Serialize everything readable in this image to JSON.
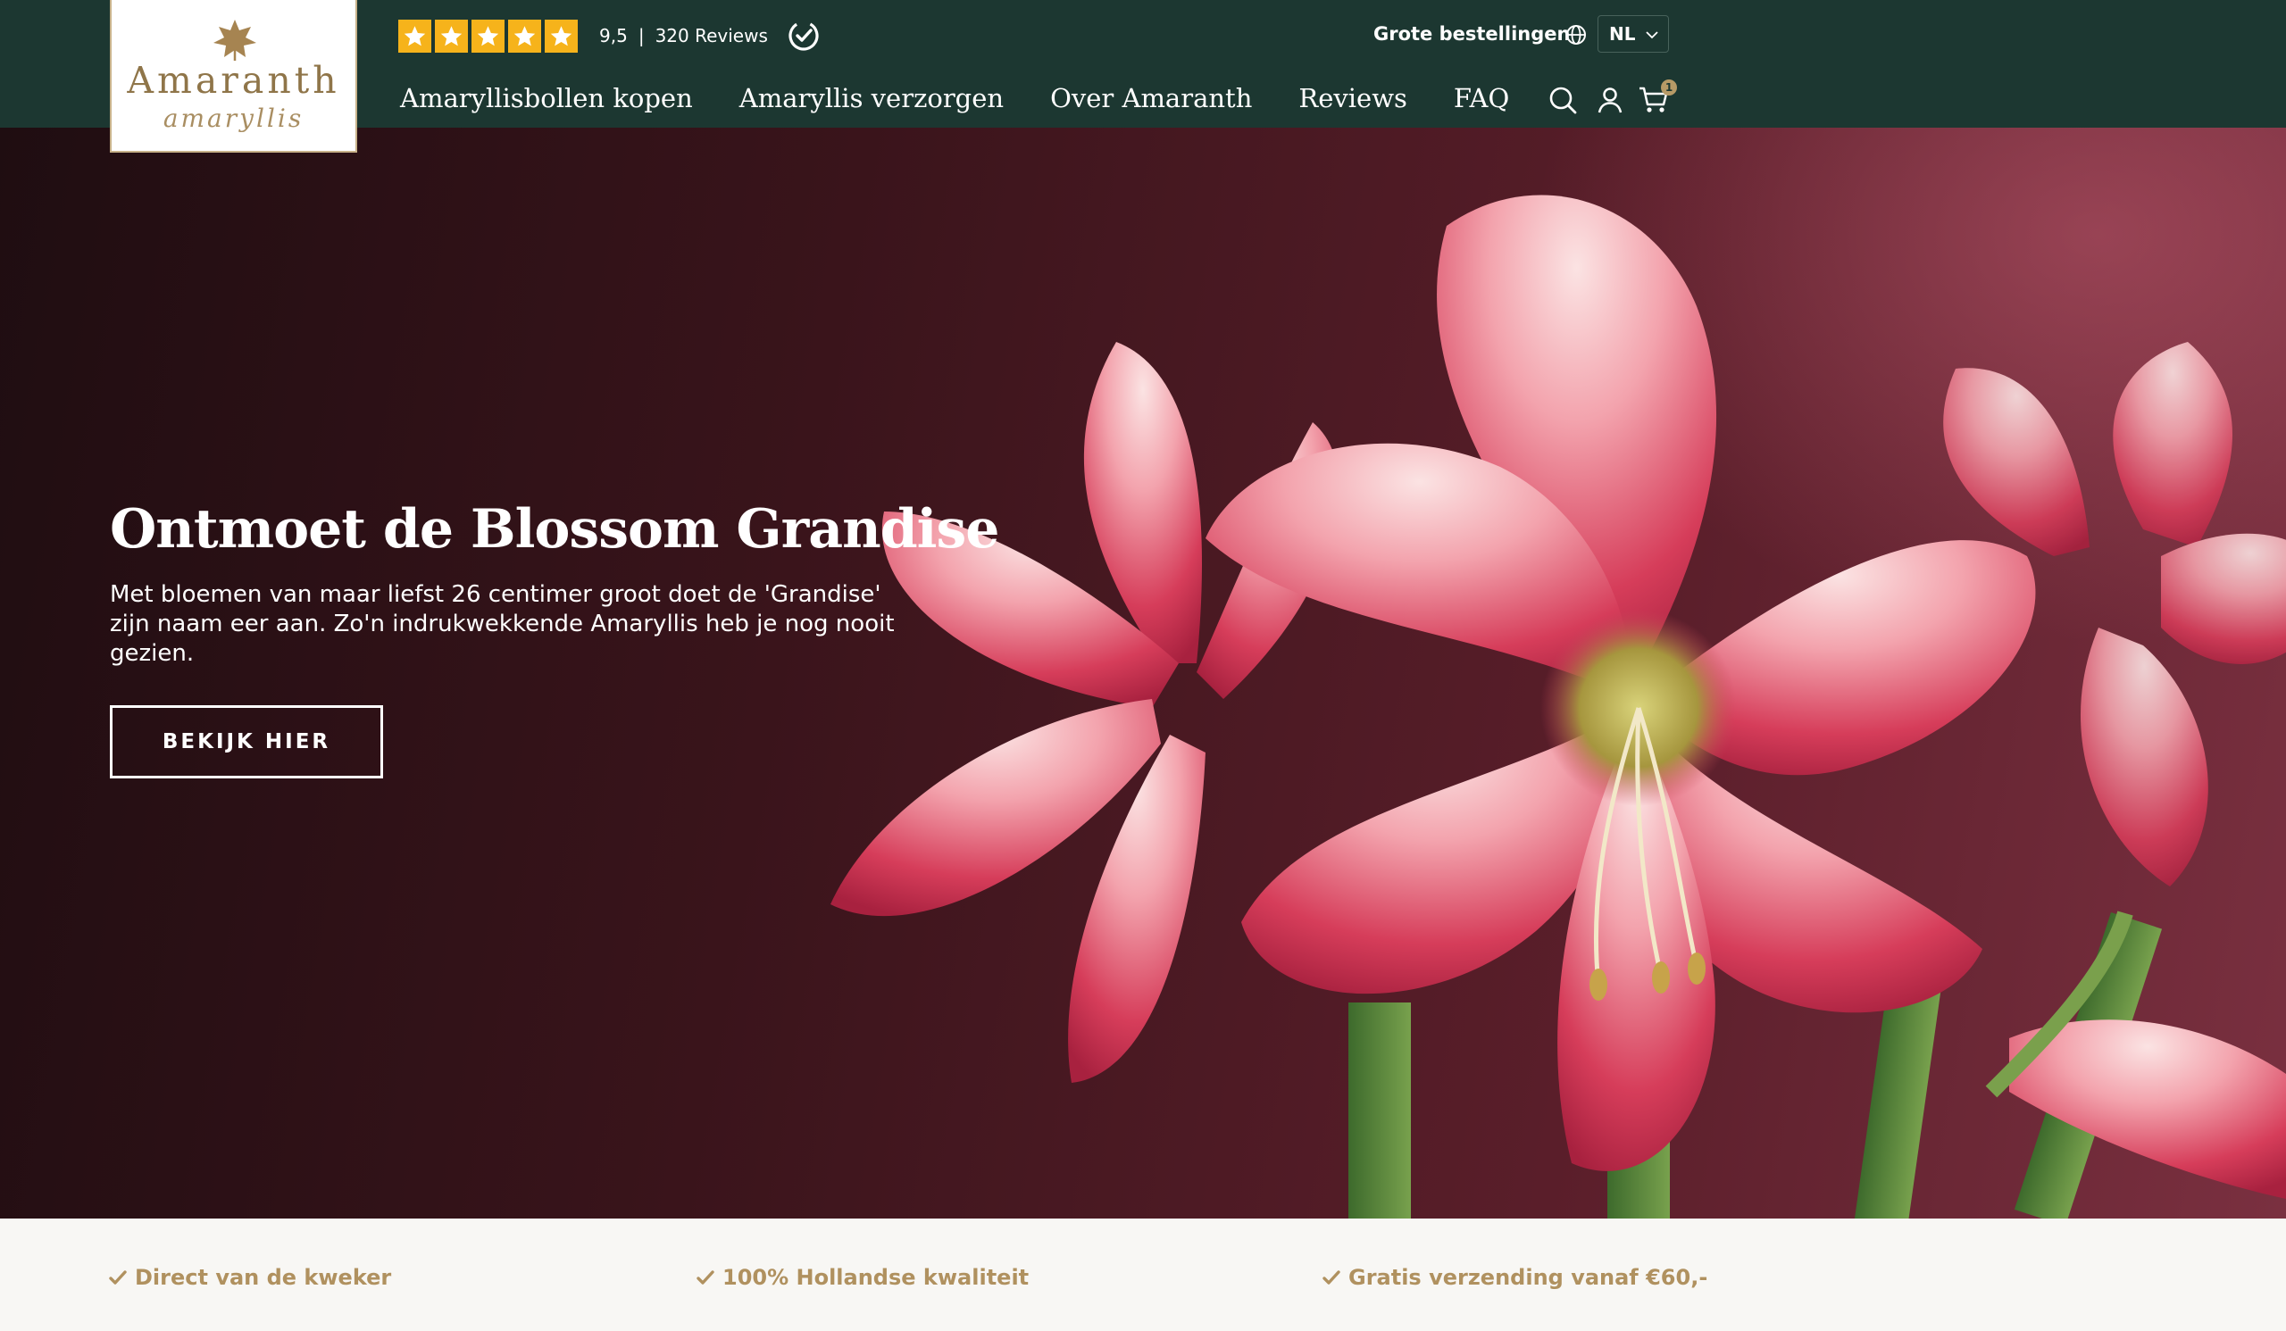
{
  "brand": {
    "name": "Amaranth",
    "tagline": "amaryllis",
    "colors": {
      "header_bg": "#1c3731",
      "gold": "#b0915f",
      "star": "#f6b31b"
    }
  },
  "rating": {
    "stars": 5,
    "score": "9,5",
    "separator": "|",
    "count": "320 Reviews"
  },
  "header": {
    "top_link": "Grote bestellingen",
    "language": "NL",
    "cart_count": "1",
    "icons": [
      "globe-icon",
      "search-icon",
      "account-icon",
      "cart-icon"
    ]
  },
  "nav": {
    "items": [
      {
        "label": "Amaryllisbollen kopen"
      },
      {
        "label": "Amaryllis verzorgen"
      },
      {
        "label": "Over Amaranth"
      },
      {
        "label": "Reviews"
      },
      {
        "label": "FAQ"
      }
    ]
  },
  "hero": {
    "title": "Ontmoet de Blossom Grandise",
    "text": "Met bloemen van maar liefst 26 centimer groot doet de 'Grandise' zijn naam eer aan. Zo'n indrukwekkende Amaryllis heb je nog nooit gezien.",
    "button": "BEKIJK HIER"
  },
  "usps": [
    {
      "label": "Direct van de kweker"
    },
    {
      "label": "100% Hollandse kwaliteit"
    },
    {
      "label": "Gratis verzending vanaf €60,-"
    }
  ]
}
